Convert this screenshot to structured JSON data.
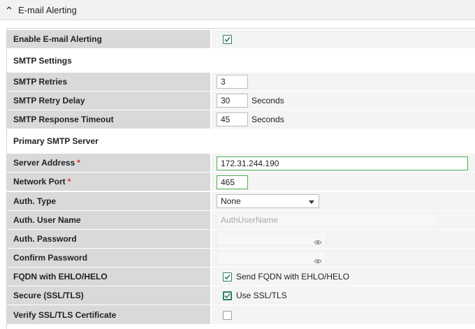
{
  "panel": {
    "title": "E-mail Alerting"
  },
  "fields": {
    "enable_alerting": {
      "label": "Enable E-mail Alerting",
      "checked": true
    },
    "smtp_settings": {
      "heading": "SMTP Settings"
    },
    "retries": {
      "label": "SMTP Retries",
      "value": "3"
    },
    "retry_delay": {
      "label": "SMTP Retry Delay",
      "value": "30",
      "unit": "Seconds"
    },
    "response_timeout": {
      "label": "SMTP Response Timeout",
      "value": "45",
      "unit": "Seconds"
    },
    "primary_server": {
      "heading": "Primary SMTP Server"
    },
    "server_address": {
      "label": "Server Address",
      "required": "*",
      "value": "172.31.244.190"
    },
    "network_port": {
      "label": "Network Port",
      "required": "*",
      "value": "465"
    },
    "auth_type": {
      "label": "Auth. Type",
      "value": "None"
    },
    "auth_user": {
      "label": "Auth. User Name",
      "placeholder": "AuthUserName"
    },
    "auth_password": {
      "label": "Auth. Password",
      "value": ""
    },
    "confirm_password": {
      "label": "Confirm Password",
      "value": ""
    },
    "fqdn": {
      "label": "FQDN with EHLO/HELO",
      "checkbox_label": "Send FQDN with EHLO/HELO",
      "checked": true
    },
    "secure": {
      "label": "Secure (SSL/TLS)",
      "checkbox_label": "Use SSL/TLS",
      "checked": true
    },
    "verify_cert": {
      "label": "Verify SSL/TLS Certificate",
      "checked": false
    }
  },
  "icons": {
    "collapse": "chevron-up-icon",
    "check": "checkmark-icon",
    "eye": "eye-icon",
    "dropdown": "caret-down-icon"
  },
  "colors": {
    "label_bg": "#d9d9d9",
    "value_bg": "#f4f4f4",
    "required": "#d32f2f",
    "focus_border": "#4caf50",
    "check": "#2e7d6b"
  }
}
